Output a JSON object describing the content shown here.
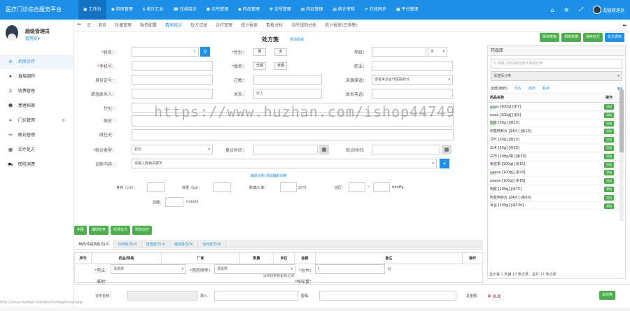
{
  "app": {
    "title": "医疗门诊综合服务平台"
  },
  "topnav": [
    {
      "icon": "desktop-icon",
      "label": "工作台",
      "active": true
    },
    {
      "icon": "dashboard-icon",
      "label": "药房管理"
    },
    {
      "icon": "dollar-icon",
      "label": "统计汇总"
    },
    {
      "icon": "phone-icon",
      "label": "在线接诊"
    },
    {
      "icon": "users-icon",
      "label": "诊所管理"
    },
    {
      "icon": "cube-icon",
      "label": "药品管理"
    },
    {
      "icon": "stethoscope-icon",
      "label": "诊所管理"
    },
    {
      "icon": "file-icon",
      "label": "药品管理"
    },
    {
      "icon": "chart-icon",
      "label": "统计审核"
    },
    {
      "icon": "sync-icon",
      "label": "在线同步"
    },
    {
      "icon": "platform-icon",
      "label": "平台管理"
    }
  ],
  "user": {
    "name": "超级管理员",
    "role": "管理员▾",
    "top_name": "超级管理员"
  },
  "sidebar": [
    {
      "icon": "gear-icon",
      "label": "药房诊疗",
      "active": true
    },
    {
      "icon": "star-icon",
      "label": "直接调药"
    },
    {
      "icon": "search-icon",
      "label": "收费管理"
    },
    {
      "icon": "user-icon",
      "label": "患者档案"
    },
    {
      "icon": "chain-icon",
      "label": "门诊管理",
      "gear": true
    },
    {
      "icon": "link-icon",
      "label": "随访管理"
    },
    {
      "icon": "calendar-icon",
      "label": "诊疗处方"
    },
    {
      "icon": "car-icon",
      "label": "医院消费"
    }
  ],
  "tabs": [
    "首页",
    "轮播管理",
    "微信配置",
    "看病就诊",
    "处方记录",
    "诊疗管理",
    "统计报表",
    "看板分析",
    "诊所规则分析",
    "统计报表(日销售)"
  ],
  "tab_active_index": 3,
  "form": {
    "title": "处方笺",
    "title_link": "添加患者",
    "buttons": [
      {
        "label": "保存草稿",
        "color": "green"
      },
      {
        "label": "调用草稿",
        "color": "green"
      },
      {
        "label": "保存处方",
        "color": "green"
      },
      {
        "label": "处方调用",
        "color": "blue"
      }
    ],
    "labels": {
      "name": "姓名：",
      "gender": "性别：",
      "age": "年龄：",
      "phone": "手机号：",
      "married": "婚否：",
      "occupation": "职业：",
      "idcard": "身份证号：",
      "allergy": "过敏：",
      "source": "来源渠道：",
      "contact": "紧急联系人：",
      "relation": "关系：",
      "contact_phone": "联系电话：",
      "address": "住址：",
      "history": "病史：",
      "chief": "既往史：",
      "visit_type": "就诊类型：",
      "recheck_time": "复诊时间：",
      "visit_time": "就诊时间：",
      "diagnosis": "诊断内容："
    },
    "gender_options": [
      "男",
      "女"
    ],
    "married_options": [
      "已婚",
      "未婚"
    ],
    "age_unit": "岁",
    "source_value": "患者来自合作医院转诊",
    "relation_value": "本人",
    "visit_type_value": "初诊",
    "diagnosis_placeholder": "请输入疾病关键字",
    "assist_links": "辅助诊断 添加辅助诊断",
    "vitals": {
      "height": "身高（cm）：",
      "weight": "体重（kg）：",
      "heart": "脉搏/心率：",
      "heart_unit": "次/分",
      "bp": "血压：",
      "bp_unit": "mmHg",
      "sugar": "血糖：",
      "sugar_unit": "mmol/l"
    },
    "action_buttons": [
      "中医",
      "辅助检查",
      "收费处方",
      "附加治疗"
    ],
    "rx_tabs": [
      "西药/中成药处方(0)",
      "中药处方(0)",
      "检查处方(0)",
      "输液处方(0)",
      "治疗处方(0)"
    ],
    "grid_headers": [
      "序号",
      "药品/规格",
      "厂家",
      "数量",
      "单位",
      "金额",
      "备注",
      "操作"
    ],
    "grid_empty": "没有找到匹配的记录",
    "bottom": {
      "usage_label": "用法：",
      "usage_value": "请选择",
      "freq_label": "用药频率：",
      "freq_value": "请选择",
      "total_label": "总共：",
      "total_value": "1",
      "total_unit": "付",
      "note_label": "嘱咐：",
      "dose_label": "每帖量："
    }
  },
  "footer": {
    "clinic_label": "诊所名称：",
    "doctor_label": "录入：",
    "med_label": "医嘱：",
    "total_label": "总金额：",
    "total_value": "￥ 0.0",
    "submit": "去结算"
  },
  "drug_panel": {
    "title": "药品库",
    "search_placeholder": "请输入药品拼音首字母或名称",
    "filter_placeholder": "请选择分类",
    "cats": [
      "全部(西药)",
      "饮片",
      "成药",
      "耗材"
    ],
    "head_name": "药品名称",
    "head_op": "操作",
    "add_label": "添加",
    "drugs": [
      {
        "name": "aaaa [100g] [余7]",
        "badge": "库存"
      },
      {
        "name": "aaaa [100g] [余9]",
        "badge": ""
      },
      {
        "name": "阿胶 [50g] [余10]",
        "badge": "库存"
      },
      {
        "name": "阿莫西林片 [24片] [余10]",
        "badge": ""
      },
      {
        "name": "艾叶 [50g] [余10]",
        "badge": ""
      },
      {
        "name": "白术 [50g] [余20]",
        "badge": ""
      },
      {
        "name": "白芍 [100g/袋] [余30]",
        "badge": ""
      },
      {
        "name": "板蓝根 [100g] [余15]",
        "badge": ""
      },
      {
        "name": "aaaaa [100g] [余20]",
        "badge": "库存"
      },
      {
        "name": "aaaaa [100g] [余16]",
        "badge": ""
      },
      {
        "name": "阿胶 [100g] [余75]",
        "badge": ""
      },
      {
        "name": "阿莫西林片 [24片] [余60]",
        "badge": ""
      },
      {
        "name": "百合 [100g] [余130]",
        "badge": ""
      }
    ],
    "pager": "显示第 1 到第 17 条记录，总共 17 条记录"
  },
  "statusbar": "http://lvhua.huzhan.com/doctor/diagnosis/view",
  "watermark": "https://www.huzhan.com/ishop44749"
}
